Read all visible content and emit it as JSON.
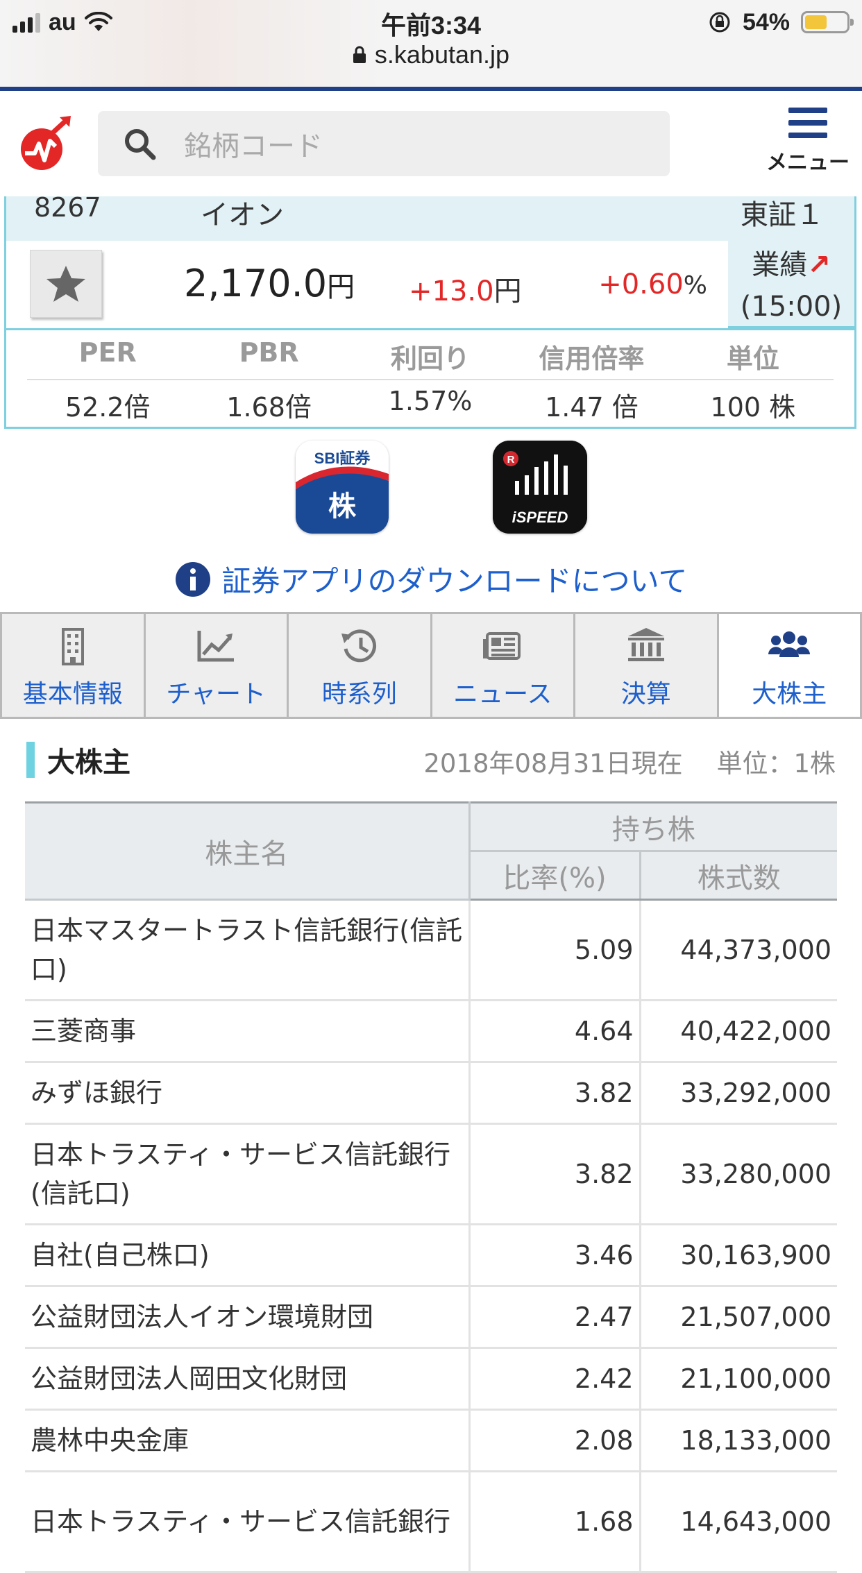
{
  "status_bar": {
    "carrier": "au",
    "time": "午前3:34",
    "battery_percent": "54%",
    "battery_level": 0.54,
    "url": "s.kabutan.jp"
  },
  "header": {
    "search_placeholder": "銘柄コード",
    "menu_label": "メニュー",
    "brand_color": "#1f3f87"
  },
  "stock": {
    "code": "8267",
    "name": "イオン",
    "market": "東証１",
    "price": "2,170.0",
    "price_unit": "円",
    "change": "+13.0",
    "change_unit": "円",
    "change_pct": "+0.60",
    "pct_unit": "%",
    "performance_label": "業績",
    "performance_arrow": "↗",
    "time": "(15:00)",
    "up_color": "#e32626"
  },
  "metrics": {
    "headers": [
      "PER",
      "PBR",
      "利回り",
      "信用倍率",
      "単位"
    ],
    "values": [
      "52.2倍",
      "1.68倍",
      "1.57%",
      "1.47 倍",
      "100 株"
    ]
  },
  "apps": {
    "sbi_brand": "SBI証券",
    "sbi_kanji": "株",
    "ispeed_label": "iSPEED",
    "ispeed_badge": "R",
    "download_text": "証券アプリのダウンロードについて"
  },
  "tabs": [
    {
      "label": "基本情報",
      "icon": "building-icon"
    },
    {
      "label": "チャート",
      "icon": "chart-line-icon"
    },
    {
      "label": "時系列",
      "icon": "history-icon"
    },
    {
      "label": "ニュース",
      "icon": "newspaper-icon"
    },
    {
      "label": "決算",
      "icon": "bank-icon"
    },
    {
      "label": "大株主",
      "icon": "users-icon",
      "active": true
    }
  ],
  "section": {
    "title": "大株主",
    "as_of": "2018年08月31日現在",
    "unit": "単位：1株"
  },
  "table": {
    "header_name": "株主名",
    "header_group": "持ち株",
    "header_ratio": "比率(%)",
    "header_shares": "株式数",
    "rows": [
      {
        "name": "日本マスタートラスト信託銀行(信託口)",
        "ratio": "5.09",
        "shares": "44,373,000"
      },
      {
        "name": "三菱商事",
        "ratio": "4.64",
        "shares": "40,422,000"
      },
      {
        "name": "みずほ銀行",
        "ratio": "3.82",
        "shares": "33,292,000"
      },
      {
        "name": "日本トラスティ・サービス信託銀行(信託口)",
        "ratio": "3.82",
        "shares": "33,280,000"
      },
      {
        "name": "自社(自己株口)",
        "ratio": "3.46",
        "shares": "30,163,900"
      },
      {
        "name": "公益財団法人イオン環境財団",
        "ratio": "2.47",
        "shares": "21,507,000"
      },
      {
        "name": "公益財団法人岡田文化財団",
        "ratio": "2.42",
        "shares": "21,100,000"
      },
      {
        "name": "農林中央金庫",
        "ratio": "2.08",
        "shares": "18,133,000"
      },
      {
        "name": "日本トラスティ・サービス信託銀行",
        "ratio": "1.68",
        "shares": "14,643,000"
      }
    ]
  }
}
